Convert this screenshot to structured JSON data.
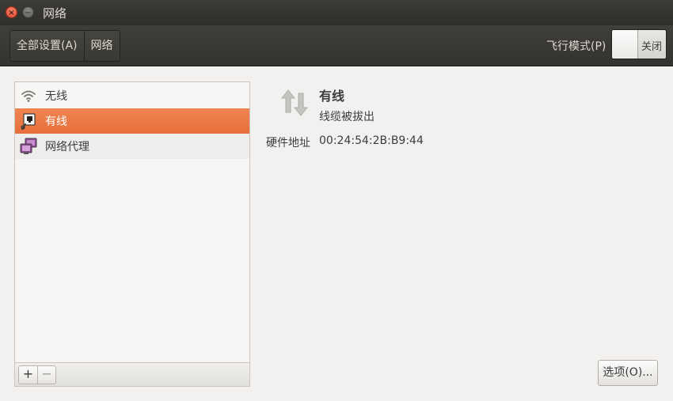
{
  "window": {
    "title": "网络",
    "close_glyph": "×",
    "minimize_glyph": "−"
  },
  "toolbar": {
    "breadcrumb": [
      "全部设置(A)",
      "网络"
    ],
    "airplane_label": "飞行模式(P)",
    "airplane_switch_state": "关闭"
  },
  "sidebar": {
    "items": [
      {
        "label": "无线",
        "icon": "wifi-icon"
      },
      {
        "label": "有线",
        "icon": "wired-network-icon",
        "selected": true
      },
      {
        "label": "网络代理",
        "icon": "network-proxy-icon"
      }
    ],
    "add_label": "+",
    "remove_label": "−"
  },
  "detail": {
    "title": "有线",
    "status": "线缆被拔出",
    "hardware_address_label": "硬件地址",
    "hardware_address_value": "00:24:54:2B:B9:44",
    "options_button_label": "选项(O)..."
  },
  "colors": {
    "selected_item": "#e9713c",
    "titlebar": "#3c3b37",
    "panel_background": "#f2f1f0"
  }
}
